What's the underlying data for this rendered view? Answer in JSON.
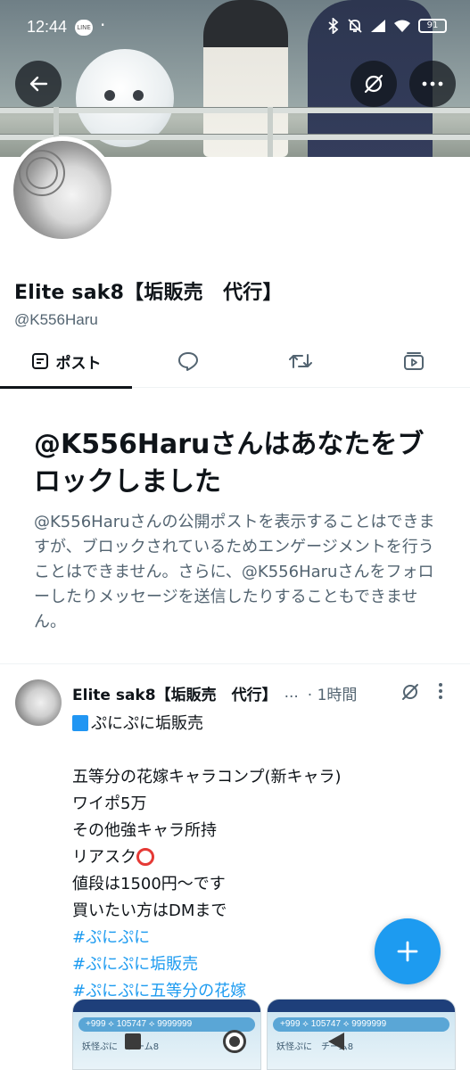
{
  "status_bar": {
    "time": "12:44",
    "battery": "91"
  },
  "profile": {
    "display_name": "Elite sak8【垢販売　代行】",
    "handle": "@K556Haru"
  },
  "tabs": [
    {
      "label": "ポスト",
      "icon": "posts-icon",
      "active": true
    },
    {
      "label": "",
      "icon": "reply-icon",
      "active": false
    },
    {
      "label": "",
      "icon": "repost-icon",
      "active": false
    },
    {
      "label": "",
      "icon": "media-icon",
      "active": false
    }
  ],
  "block_notice": {
    "title": "@K556Haruさんはあなたをブロックしました",
    "body": "@K556Haruさんの公開ポストを表示することはできますが、ブロックされているためエンゲージメントを行うことはできません。さらに、@K556Haruさんをフォローしたりメッセージを送信したりすることもできません。"
  },
  "post": {
    "author": "Elite sak8【垢販売　代行】",
    "ellipsis": "...",
    "time": "· 1時間",
    "lines": [
      "ぷにぷに垢販売",
      "",
      "五等分の花嫁キャラコンプ(新キャラ)",
      "ワイポ5万",
      "その他強キャラ所持",
      "リアスク",
      "値段は1500円〜です",
      "買いたい方はDMまで"
    ],
    "hashtags": [
      "#ぷにぷに",
      "#ぷにぷに垢販売",
      "#ぷにぷに五等分の花嫁"
    ],
    "media": [
      {
        "bar_text": "+999 ⟡ 105747 ⟡ 9999999",
        "sub_text": "妖怪ぷに　チーム8"
      },
      {
        "bar_text": "+999 ⟡ 105747 ⟡ 9999999",
        "sub_text": "妖怪ぷに　チーム8"
      }
    ]
  },
  "colors": {
    "accent": "#1d9bf0",
    "text_primary": "#0f1419",
    "text_secondary": "#536471"
  }
}
